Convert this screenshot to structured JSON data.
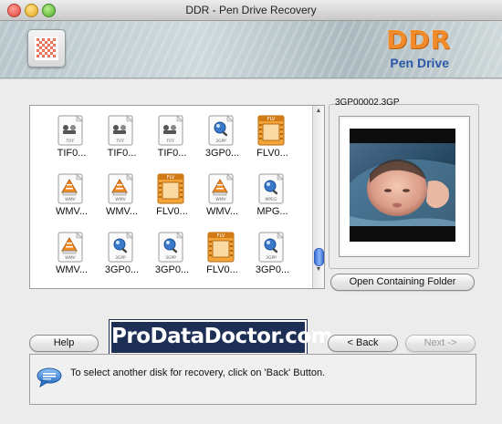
{
  "window": {
    "title": "DDR - Pen Drive Recovery"
  },
  "banner": {
    "brand": "DDR",
    "subtitle": "Pen Drive"
  },
  "files": [
    {
      "label": "TIF0...",
      "type": "tiff",
      "tag": "TIFF"
    },
    {
      "label": "TIF0...",
      "type": "tiff",
      "tag": "TIFF"
    },
    {
      "label": "TIF0...",
      "type": "tiff",
      "tag": "TIFF"
    },
    {
      "label": "3GP0...",
      "type": "3gp",
      "tag": "3GPP"
    },
    {
      "label": "FLV0...",
      "type": "flv",
      "tag": "FLV"
    },
    {
      "label": "WMV...",
      "type": "wmv",
      "tag": "WMV"
    },
    {
      "label": "WMV...",
      "type": "wmv",
      "tag": "WMV"
    },
    {
      "label": "FLV0...",
      "type": "flv",
      "tag": "FLV"
    },
    {
      "label": "WMV...",
      "type": "wmv",
      "tag": "WMV"
    },
    {
      "label": "MPG...",
      "type": "mpg",
      "tag": "MPEG"
    },
    {
      "label": "WMV...",
      "type": "wmv",
      "tag": "WMV"
    },
    {
      "label": "3GP0...",
      "type": "3gp",
      "tag": "3GPP"
    },
    {
      "label": "3GP0...",
      "type": "3gp",
      "tag": "3GPP"
    },
    {
      "label": "FLV0...",
      "type": "flv",
      "tag": "FLV"
    },
    {
      "label": "3GP0...",
      "type": "3gp",
      "tag": "3GPP"
    }
  ],
  "preview": {
    "caption": "3GP00002.3GP",
    "open_folder_label": "Open Containing Folder"
  },
  "buttons": {
    "help": "Help",
    "back": "< Back",
    "next": "Next ->"
  },
  "watermark": "ProDataDoctor.com",
  "status": {
    "message": "To select another disk for recovery, click on 'Back' Button."
  },
  "colors": {
    "brand_orange": "#f08a2a",
    "brand_blue": "#2a57a8",
    "scroll_blue": "#3a6fd8",
    "watermark_bg": "#1e2f55"
  }
}
